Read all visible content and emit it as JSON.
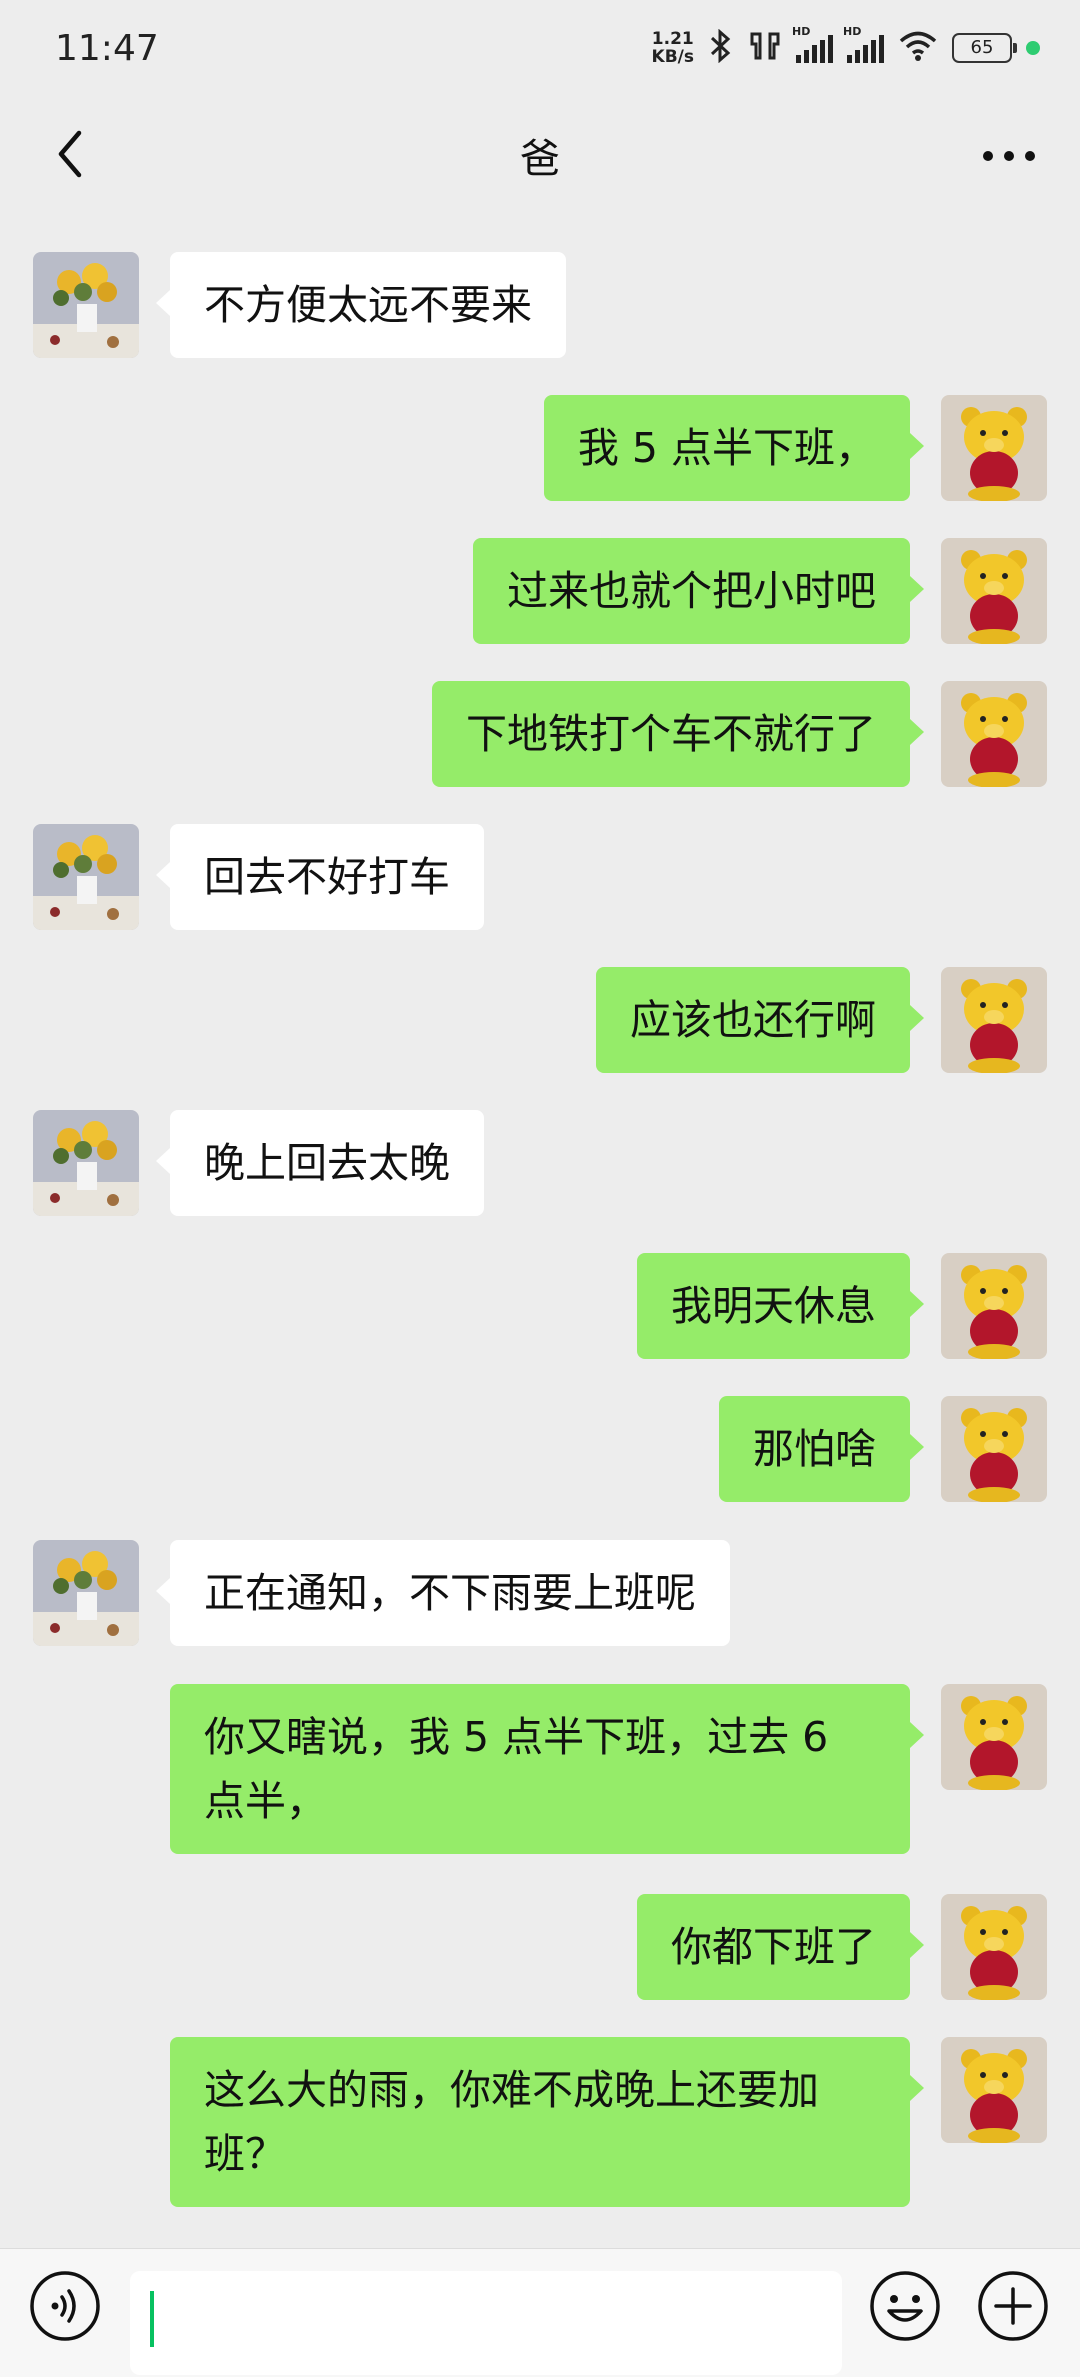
{
  "status_bar": {
    "time": "11:47",
    "net_speed_value": "1.21",
    "net_speed_unit": "KB/s",
    "hd_label_1": "HD",
    "hd_label_2": "HD",
    "battery": "65"
  },
  "header": {
    "title": "爸"
  },
  "colors": {
    "sent_bubble": "#95ec69",
    "received_bubble": "#ffffff",
    "background": "#ededed",
    "accent": "#07c160"
  },
  "messages": [
    {
      "side": "left",
      "text": "不方便太远不要来"
    },
    {
      "side": "right",
      "text": "我 5 点半下班，"
    },
    {
      "side": "right",
      "text": "过来也就个把小时吧"
    },
    {
      "side": "right",
      "text": "下地铁打个车不就行了"
    },
    {
      "side": "left",
      "text": "回去不好打车"
    },
    {
      "side": "right",
      "text": "应该也还行啊"
    },
    {
      "side": "left",
      "text": "晚上回去太晚"
    },
    {
      "side": "right",
      "text": "我明天休息"
    },
    {
      "side": "right",
      "text": "那怕啥"
    },
    {
      "side": "left",
      "text": "正在通知，不下雨要上班呢"
    },
    {
      "side": "right",
      "text": "你又瞎说，我 5 点半下班，过去 6 点半，"
    },
    {
      "side": "right",
      "text": "你都下班了"
    },
    {
      "side": "right",
      "text": "这么大的雨，你难不成晚上还要加班？"
    }
  ],
  "icons": {
    "back": "chevron-left-icon",
    "more": "more-dots-icon",
    "voice": "voice-icon",
    "emoji": "emoji-icon",
    "plus": "plus-icon",
    "dad_avatar": "flower-vase-avatar",
    "my_avatar": "yellow-bear-avatar"
  }
}
